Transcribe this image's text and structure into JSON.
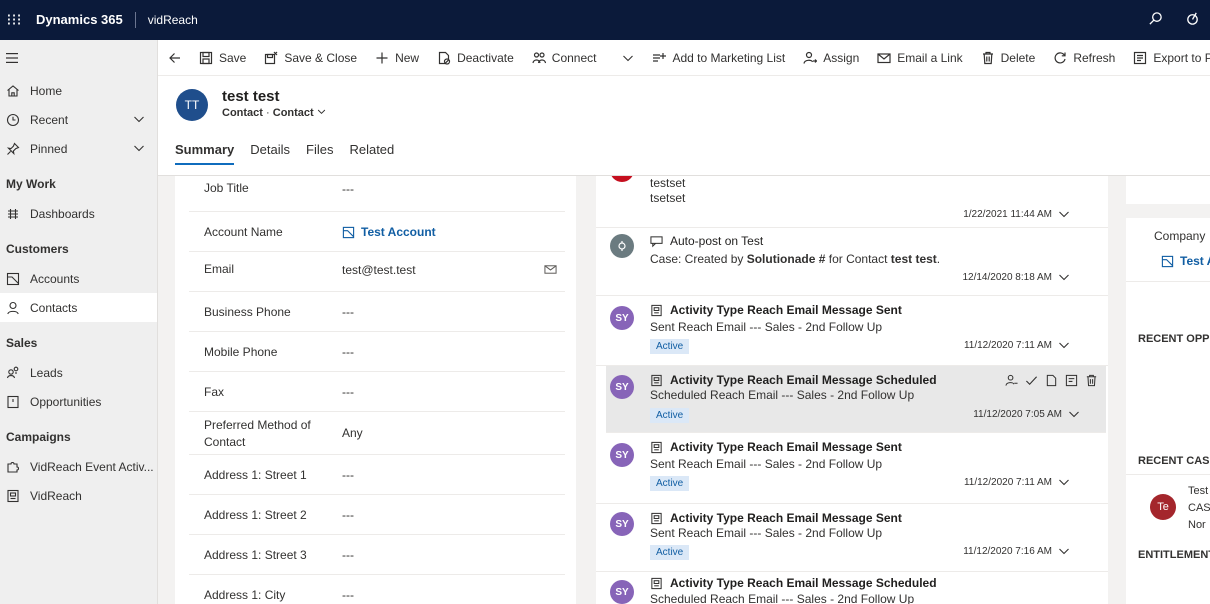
{
  "topbar": {
    "brand": "Dynamics 365",
    "app": "vidReach"
  },
  "sidebar": {
    "items": [
      {
        "label": "Home",
        "icon": "home-icon"
      },
      {
        "label": "Recent",
        "icon": "clock-icon"
      },
      {
        "label": "Pinned",
        "icon": "pin-icon"
      }
    ],
    "groups": {
      "mywork": {
        "title": "My Work",
        "items": [
          {
            "label": "Dashboards"
          }
        ]
      },
      "customers": {
        "title": "Customers",
        "items": [
          {
            "label": "Accounts"
          },
          {
            "label": "Contacts"
          }
        ]
      },
      "sales": {
        "title": "Sales",
        "items": [
          {
            "label": "Leads"
          },
          {
            "label": "Opportunities"
          }
        ]
      },
      "campaigns": {
        "title": "Campaigns",
        "items": [
          {
            "label": "VidReach Event Activ..."
          },
          {
            "label": "VidReach"
          }
        ]
      }
    }
  },
  "commands": {
    "save": "Save",
    "save_close": "Save & Close",
    "new": "New",
    "deactivate": "Deactivate",
    "connect": "Connect",
    "add_marketing": "Add to Marketing List",
    "assign": "Assign",
    "email_link": "Email a Link",
    "delete": "Delete",
    "refresh": "Refresh",
    "export_pdf": "Export to PDF"
  },
  "record": {
    "initials": "TT",
    "name": "test test",
    "entity": "Contact",
    "form": "Contact",
    "tabs": [
      "Summary",
      "Details",
      "Files",
      "Related"
    ]
  },
  "form": {
    "fields": [
      {
        "label": "Job Title",
        "value": "---"
      },
      {
        "label": "Account Name",
        "value": "Test Account"
      },
      {
        "label": "Email",
        "value": "test@test.test"
      },
      {
        "label": "Business Phone",
        "value": "---"
      },
      {
        "label": "Mobile Phone",
        "value": "---"
      },
      {
        "label": "Fax",
        "value": "---"
      },
      {
        "label": "Preferred Method of Contact",
        "value": "Any"
      },
      {
        "label": "Address 1: Street 1",
        "value": "---"
      },
      {
        "label": "Address 1: Street 2",
        "value": "---"
      },
      {
        "label": "Address 1: Street 3",
        "value": "---"
      },
      {
        "label": "Address 1: City",
        "value": "---"
      }
    ]
  },
  "timeline": {
    "items": [
      {
        "title": "",
        "sub1": "testset",
        "sub2": "tsetset",
        "date": "1/22/2021 11:44 AM"
      },
      {
        "title": "Auto-post on Test",
        "sub_pre": "Case: Created by ",
        "sub_bold1": "Solutionade #",
        "sub_mid": " for Contact ",
        "sub_bold2": "test test",
        "sub_end": ".",
        "date": "12/14/2020 8:18 AM"
      },
      {
        "initials": "SY",
        "title": "Activity Type Reach Email Message Sent",
        "sub": "Sent Reach Email --- Sales - 2nd Follow Up",
        "badge": "Active",
        "date": "11/12/2020 7:11 AM"
      },
      {
        "initials": "SY",
        "title": "Activity Type Reach Email Message Scheduled",
        "sub": "Scheduled Reach Email --- Sales - 2nd Follow Up",
        "badge": "Active",
        "date": "11/12/2020 7:05 AM"
      },
      {
        "initials": "SY",
        "title": "Activity Type Reach Email Message Sent",
        "sub": "Sent Reach Email --- Sales - 2nd Follow Up",
        "badge": "Active",
        "date": "11/12/2020 7:11 AM"
      },
      {
        "initials": "SY",
        "title": "Activity Type Reach Email Message Sent",
        "sub": "Sent Reach Email --- Sales - 2nd Follow Up",
        "badge": "Active",
        "date": "11/12/2020 7:16 AM"
      },
      {
        "initials": "SY",
        "title": "Activity Type Reach Email Message Scheduled",
        "sub": "Scheduled Reach Email --- Sales - 2nd Follow Up"
      }
    ]
  },
  "right": {
    "company_label": "Company",
    "company_value": "Test A",
    "sec_opp": "RECENT OPPO",
    "sec_cases": "RECENT CASE",
    "case_initials": "Te",
    "case_l1": "Test",
    "case_l2": "CAS",
    "case_l3": "Nor",
    "sec_ent": "ENTITLEMENT"
  },
  "colors": {
    "topbar": "#0b1a3a",
    "accent": "#115ea3",
    "persona_purple": "#8764b8",
    "case_red": "#a4262c"
  }
}
